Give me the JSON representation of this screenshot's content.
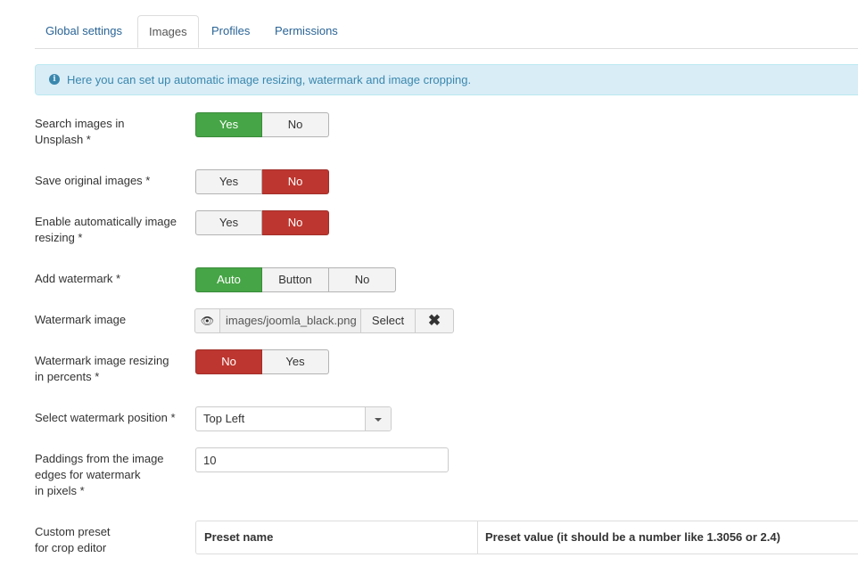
{
  "tabs": [
    {
      "label": "Global settings",
      "active": false
    },
    {
      "label": "Images",
      "active": true
    },
    {
      "label": "Profiles",
      "active": false
    },
    {
      "label": "Permissions",
      "active": false
    }
  ],
  "info": {
    "icon": "info-icon",
    "text": "Here you can set up automatic image resizing, watermark and image cropping."
  },
  "fields": {
    "unsplash": {
      "label_line1": "Search images in",
      "label_line2": "Unsplash *",
      "options": [
        "Yes",
        "No"
      ],
      "selected": "Yes"
    },
    "save_original": {
      "label": "Save original images *",
      "options": [
        "Yes",
        "No"
      ],
      "selected": "No"
    },
    "auto_resize": {
      "label_line1": "Enable automatically image",
      "label_line2": "resizing *",
      "options": [
        "Yes",
        "No"
      ],
      "selected": "No"
    },
    "add_watermark": {
      "label": "Add watermark *",
      "options": [
        "Auto",
        "Button",
        "No"
      ],
      "selected": "Auto"
    },
    "watermark_image": {
      "label": "Watermark image",
      "value": "images/joomla_black.png",
      "select_label": "Select",
      "clear_icon": "close-icon",
      "preview_icon": "eye-icon"
    },
    "watermark_percent": {
      "label_line1": "Watermark image resizing",
      "label_line2": "in percents *",
      "options": [
        "No",
        "Yes"
      ],
      "selected": "No"
    },
    "watermark_position": {
      "label": "Select watermark position *",
      "value": "Top Left"
    },
    "paddings": {
      "label_line1": "Paddings from the image",
      "label_line2": "edges for watermark",
      "label_line3": "in pixels *",
      "value": "10"
    },
    "crop_preset": {
      "label_line1": "Custom preset",
      "label_line2": "for crop editor",
      "columns": [
        "Preset name",
        "Preset value (it should be a number like 1.3056 or 2.4)"
      ]
    }
  },
  "colors": {
    "yes_green": "#46a546",
    "no_red": "#bd362f",
    "info_bg": "#d9edf7",
    "link_blue": "#2a6496"
  }
}
